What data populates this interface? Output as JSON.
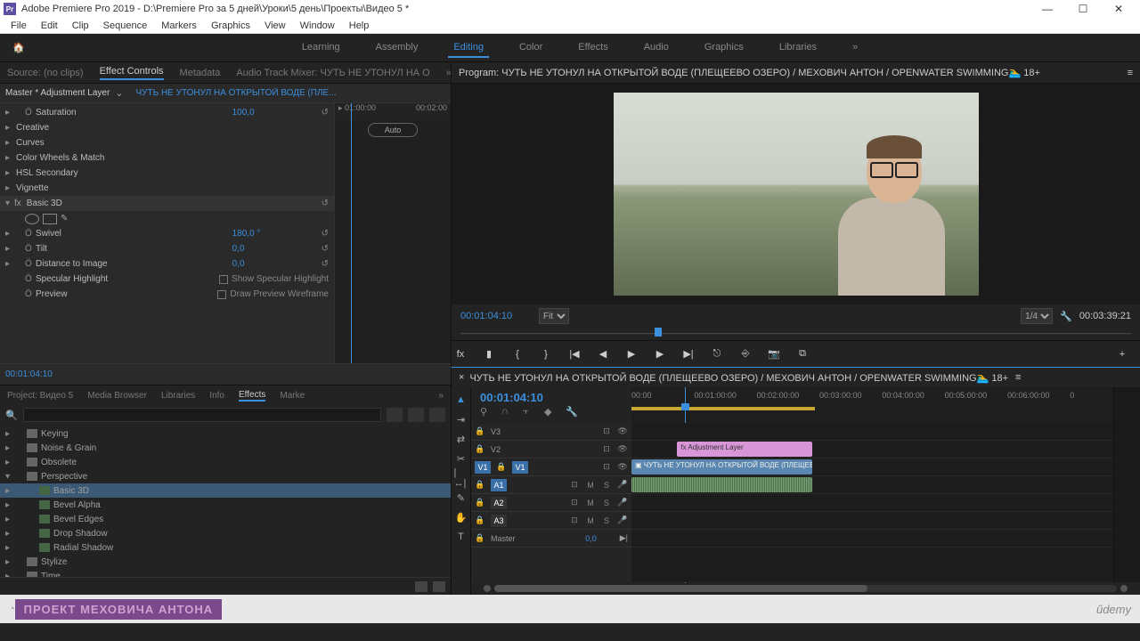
{
  "titlebar": {
    "app": "Pr",
    "title": "Adobe Premiere Pro 2019 - D:\\Premiere Pro  за 5 дней\\Уроки\\5 день\\Проекты\\Видео 5 *"
  },
  "menu": [
    "File",
    "Edit",
    "Clip",
    "Sequence",
    "Markers",
    "Graphics",
    "View",
    "Window",
    "Help"
  ],
  "workspaces": {
    "items": [
      "Learning",
      "Assembly",
      "Editing",
      "Color",
      "Effects",
      "Audio",
      "Graphics",
      "Libraries"
    ],
    "active": "Editing"
  },
  "source_tabs": {
    "items": [
      "Source: (no clips)",
      "Effect Controls",
      "Metadata",
      "Audio Track Mixer: ЧУТЬ НЕ УТОНУЛ НА О"
    ],
    "active": "Effect Controls"
  },
  "effect_controls": {
    "master": "Master * Adjustment Layer",
    "sequence": "ЧУТЬ НЕ УТОНУЛ НА ОТКРЫТОЙ ВОДЕ (ПЛЕ...",
    "ruler": {
      "start": "01:00:00",
      "end": "00:02:00"
    },
    "auto": "Auto",
    "rows": [
      {
        "ind": 2,
        "sw": "Ö",
        "name": "Saturation",
        "val": "100,0",
        "rst": "↺"
      },
      {
        "ind": 1,
        "name": "Creative"
      },
      {
        "ind": 1,
        "name": "Curves"
      },
      {
        "ind": 1,
        "name": "Color Wheels & Match"
      },
      {
        "ind": 1,
        "name": "HSL Secondary"
      },
      {
        "ind": 1,
        "name": "Vignette"
      }
    ],
    "basic3d": {
      "title": "Basic 3D",
      "swivel": {
        "name": "Swivel",
        "val": "180,0 °"
      },
      "tilt": {
        "name": "Tilt",
        "val": "0,0"
      },
      "dist": {
        "name": "Distance to Image",
        "val": "0,0"
      },
      "spec": {
        "name": "Specular Highlight",
        "chk": "Show Specular Highlight"
      },
      "prev": {
        "name": "Preview",
        "chk": "Draw Preview Wireframe"
      }
    },
    "timecode": "00:01:04:10"
  },
  "project_tabs": {
    "items": [
      "Project: Видео 5",
      "Media Browser",
      "Libraries",
      "Info",
      "Effects",
      "Marke"
    ],
    "active": "Effects"
  },
  "effects_tree": [
    {
      "ind": 1,
      "type": "fold",
      "name": "Keying"
    },
    {
      "ind": 1,
      "type": "fold",
      "name": "Noise & Grain"
    },
    {
      "ind": 1,
      "type": "fold",
      "name": "Obsolete"
    },
    {
      "ind": 1,
      "type": "fold",
      "name": "Perspective",
      "open": true
    },
    {
      "ind": 2,
      "type": "fx",
      "name": "Basic 3D",
      "sel": true
    },
    {
      "ind": 2,
      "type": "fx",
      "name": "Bevel Alpha"
    },
    {
      "ind": 2,
      "type": "fx",
      "name": "Bevel Edges"
    },
    {
      "ind": 2,
      "type": "fx",
      "name": "Drop Shadow"
    },
    {
      "ind": 2,
      "type": "fx",
      "name": "Radial Shadow"
    },
    {
      "ind": 1,
      "type": "fold",
      "name": "Stylize"
    },
    {
      "ind": 1,
      "type": "fold",
      "name": "Time"
    }
  ],
  "program": {
    "title": "Program: ЧУТЬ НЕ УТОНУЛ НА ОТКРЫТОЙ ВОДЕ (ПЛЕЩЕЕВО ОЗЕРО) / МЕХОВИЧ АНТОН / OPENWATER SWIMMING🏊‍♂️ 18+",
    "timecode": "00:01:04:10",
    "fit": "Fit",
    "zoom": "1/4",
    "duration": "00:03:39:21"
  },
  "timeline": {
    "title": "ЧУТЬ НЕ УТОНУЛ НА ОТКРЫТОЙ ВОДЕ (ПЛЕЩЕЕВО ОЗЕРО) / МЕХОВИЧ АНТОН / OPENWATER SWIMMING🏊‍♂️ 18+",
    "timecode": "00:01:04:10",
    "marks": [
      "00:00",
      "00:01:00:00",
      "00:02:00:00",
      "00:03:00:00",
      "00:04:00:00",
      "00:05:00:00",
      "00:06:00:00",
      "0"
    ],
    "tracks": {
      "v3": "V3",
      "v2": "V2",
      "v1": "V1",
      "a1": "A1",
      "a2": "A2",
      "a3": "A3",
      "master": "Master",
      "master_val": "0,0"
    },
    "clips": {
      "adj": "fx  Adjustment Layer",
      "vid": "ЧУТЬ НЕ УТОНУЛ НА ОТКРЫТОЙ ВОДЕ (ПЛЕЩЕЕВО ОЗЕРО) / МЕХО"
    }
  },
  "footer": {
    "brand": "ПРОЕКТ МЕХОВИЧА АНТОНА",
    "udemy": "ûdemy"
  }
}
